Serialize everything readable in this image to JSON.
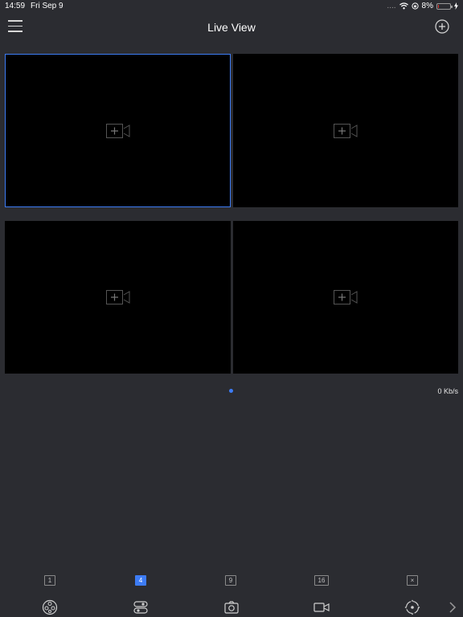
{
  "status": {
    "time": "14:59",
    "date": "Fri Sep 9",
    "dots": "....",
    "battery": "8%",
    "battery_fraction": 0.08,
    "battery_color": "#e53935"
  },
  "nav": {
    "title": "Live View"
  },
  "accent_color": "#3d7cf5",
  "tiles": [
    {
      "selected": true,
      "icon": "add-camera-icon"
    },
    {
      "selected": false,
      "icon": "add-camera-icon"
    },
    {
      "selected": false,
      "icon": "add-camera-icon"
    },
    {
      "selected": false,
      "icon": "add-camera-icon"
    }
  ],
  "bitrate": "0 Kb/s",
  "layout_options": [
    {
      "label": "1",
      "active": false
    },
    {
      "label": "4",
      "active": true
    },
    {
      "label": "9",
      "active": false
    },
    {
      "label": "16",
      "active": false
    },
    {
      "label": "×",
      "active": false
    }
  ],
  "actions": [
    {
      "icon": "reel-icon"
    },
    {
      "icon": "toggle-icon"
    },
    {
      "icon": "camera-icon"
    },
    {
      "icon": "video-icon"
    },
    {
      "icon": "ptz-icon"
    }
  ],
  "next_icon": "chevron-right-icon"
}
